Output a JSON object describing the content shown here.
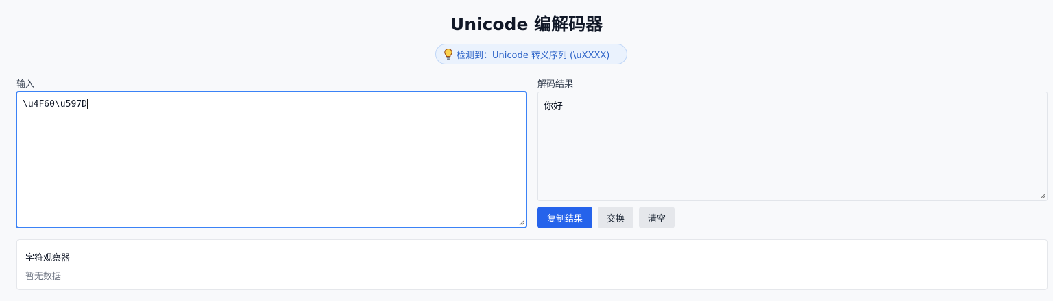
{
  "header": {
    "title": "Unicode 编解码器"
  },
  "detect_badge": {
    "icon": "lightbulb-icon",
    "text": "检测到：Unicode 转义序列 (\\uXXXX)"
  },
  "input": {
    "label": "输入",
    "value": "\\u4F60\\u597D"
  },
  "output": {
    "label": "解码结果",
    "value": "你好"
  },
  "actions": {
    "copy_label": "复制结果",
    "swap_label": "交换",
    "clear_label": "清空"
  },
  "inspector": {
    "title": "字符观察器",
    "empty_text": "暂无数据"
  },
  "colors": {
    "accent": "#2563eb",
    "badge_bg": "#eaf2fd",
    "badge_text": "#2b62c7"
  }
}
